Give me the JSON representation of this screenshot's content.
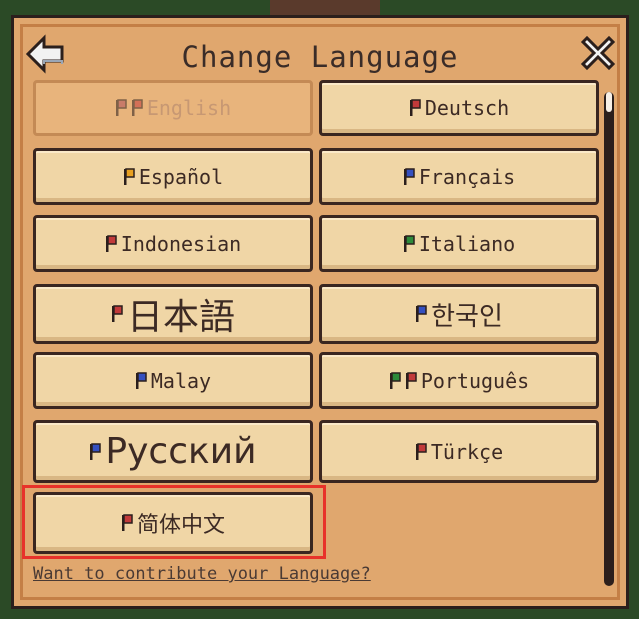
{
  "header": {
    "title": "Change Language",
    "back_icon": "back-arrow-icon",
    "close_icon": "close-x-icon"
  },
  "languages": [
    {
      "label": "English",
      "flags": [
        "#b0505a",
        "#c23a3a"
      ],
      "selected": true
    },
    {
      "label": "Deutsch",
      "flags": [
        "#c23a3a"
      ]
    },
    {
      "label": "Español",
      "flags": [
        "#e8a020"
      ]
    },
    {
      "label": "Français",
      "flags": [
        "#3550c0"
      ]
    },
    {
      "label": "Indonesian",
      "flags": [
        "#c23a3a"
      ]
    },
    {
      "label": "Italiano",
      "flags": [
        "#2d8a3a"
      ]
    },
    {
      "label": "日本語",
      "flags": [
        "#c23a3a"
      ]
    },
    {
      "label": "한국인",
      "flags": [
        "#3550c0"
      ]
    },
    {
      "label": "Malay",
      "flags": [
        "#3550c0"
      ]
    },
    {
      "label": "Português",
      "flags": [
        "#2d8a3a",
        "#c23a3a"
      ]
    },
    {
      "label": "Русский",
      "flags": [
        "#3550c0"
      ]
    },
    {
      "label": "Türkçe",
      "flags": [
        "#c23a3a"
      ]
    },
    {
      "label": "简体中文",
      "flags": [
        "#c23a3a"
      ]
    }
  ],
  "footer": {
    "contribute_link": "Want to contribute your Language?"
  },
  "colors": {
    "panel": "#e0a76e",
    "button": "#f0d6a6",
    "highlight": "#e8322a"
  }
}
